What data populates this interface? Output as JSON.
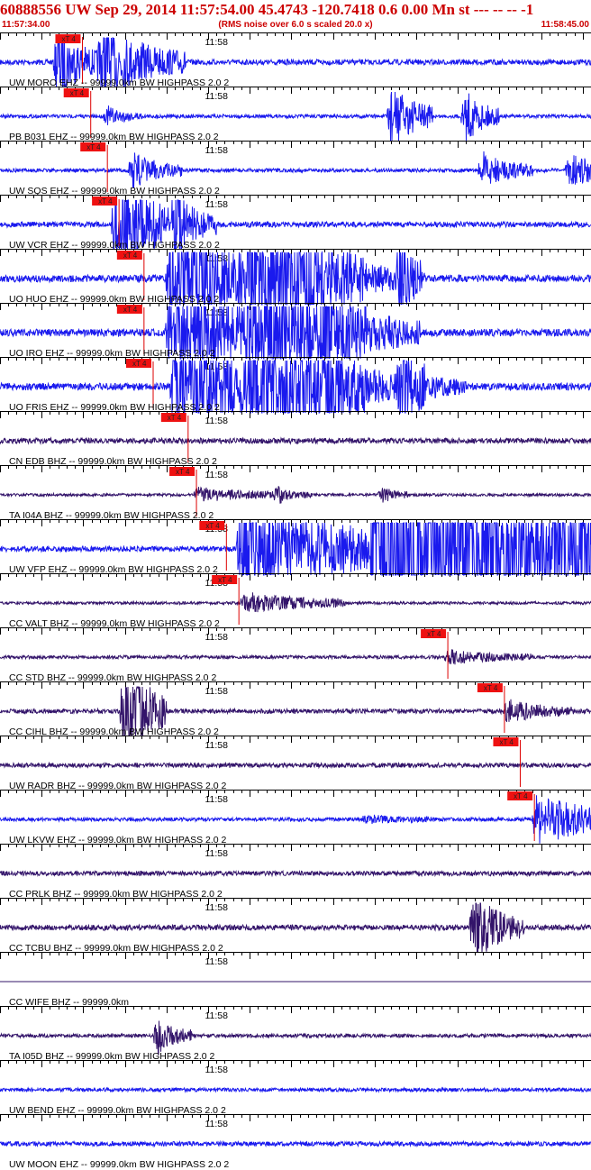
{
  "header": {
    "title": "60888556 UW Sep 29, 2014 11:57:54.00   45.4743 -120.7418  0.6 0.00 Mn st --- -- --  -1",
    "start_time": "11:57:34.00",
    "noise_note": "(RMS noise over 6.0 s scaled 20.0 x)",
    "end_time": "11:58:45.00"
  },
  "chart_data": {
    "type": "line",
    "x_unit": "seconds after 11:57:34.00",
    "xlim": [
      0,
      71
    ],
    "minute_mark": {
      "label": "11:58",
      "t": 26
    },
    "pick_label": "xT 4",
    "colors": {
      "ehz": "#1a1aee",
      "bhz": "#33146a",
      "pick_box": "#ee1111",
      "pick_line": "#dd0000",
      "axis": "#000000"
    },
    "traces": [
      {
        "label": "UW MORO EHZ -- 99999.0km BW  HIGHPASS  2.0  2",
        "kind": "ehz",
        "pick": 9.9,
        "amp": 3,
        "bursts": [
          [
            12.3,
            10,
            3.5
          ],
          [
            7,
            6,
            3
          ]
        ],
        "clip": false,
        "flat": false
      },
      {
        "label": "PB B031 EHZ -- 99999.0km BW  HIGHPASS  2.0  2",
        "kind": "ehz",
        "pick": 10.9,
        "amp": 2,
        "bursts": [
          [
            13,
            4,
            1
          ],
          [
            47,
            5,
            4
          ],
          [
            56,
            4,
            3
          ]
        ],
        "clip": false,
        "flat": false
      },
      {
        "label": "UW SQS EHZ -- 99999.0km BW  HIGHPASS  2.0  2",
        "kind": "ehz",
        "pick": 12.9,
        "amp": 2,
        "bursts": [
          [
            16,
            6,
            2
          ],
          [
            58,
            6,
            2
          ],
          [
            68.5,
            12,
            1.6
          ]
        ],
        "clip": false,
        "flat": false
      },
      {
        "label": "UW VCR EHZ -- 99999.0km BW  HIGHPASS  2.0  2",
        "kind": "ehz",
        "pick": 14.3,
        "amp": 3,
        "bursts": [
          [
            14,
            8,
            5
          ],
          [
            21,
            5,
            3
          ]
        ],
        "clip": false,
        "flat": false
      },
      {
        "label": "UO HUO EHZ -- 99999.0km BW  HIGHPASS  2.0  2",
        "kind": "ehz",
        "pick": 17.3,
        "amp": 4,
        "bursts": [
          [
            20.5,
            30,
            3
          ],
          [
            30,
            14,
            3
          ],
          [
            36,
            6,
            1.5
          ],
          [
            48,
            3,
            2
          ]
        ],
        "clip": true,
        "flat": false
      },
      {
        "label": "UO IRO EHZ -- 99999.0km BW  HIGHPASS  2.0  2",
        "kind": "ehz",
        "pick": 17.3,
        "amp": 4,
        "bursts": [
          [
            20.5,
            30,
            3
          ],
          [
            30,
            14,
            3
          ],
          [
            38,
            10,
            1
          ],
          [
            35.5,
            6,
            0.8
          ]
        ],
        "clip": true,
        "flat": false
      },
      {
        "label": "UO FRIS EHZ -- 99999.0km BW  HIGHPASS  2.0  2",
        "kind": "ehz",
        "pick": 18.4,
        "amp": 4,
        "bursts": [
          [
            21,
            30,
            3
          ],
          [
            30,
            14,
            3
          ],
          [
            38,
            8,
            1
          ],
          [
            48,
            8,
            1.5
          ]
        ],
        "clip": true,
        "flat": false
      },
      {
        "label": "CN EDB BHZ -- 99999.0km BW  HIGHPASS  2.0  2",
        "kind": "bhz",
        "pick": 22.6,
        "amp": 3,
        "bursts": [],
        "clip": false,
        "flat": false
      },
      {
        "label": "TA I04A BHZ -- 99999.0km BW  HIGHPASS  2.0  2",
        "kind": "bhz",
        "pick": 23.6,
        "amp": 1.5,
        "bursts": [
          [
            23.8,
            10,
            1
          ],
          [
            33.5,
            4,
            0.8
          ],
          [
            46,
            3,
            1
          ]
        ],
        "clip": false,
        "flat": false
      },
      {
        "label": "UW VFP EHZ -- 99999.0km BW  HIGHPASS  2.0  2",
        "kind": "ehz",
        "pick": 27.2,
        "amp": 3,
        "bursts": [
          [
            29,
            30,
            4
          ],
          [
            45,
            30,
            12
          ],
          [
            67,
            30,
            4
          ]
        ],
        "clip": true,
        "flat": false
      },
      {
        "label": "CC VALT BHZ -- 99999.0km BW  HIGHPASS  2.0  2",
        "kind": "bhz",
        "pick": 28.7,
        "amp": 1.5,
        "bursts": [
          [
            29.5,
            12,
            1.5
          ]
        ],
        "clip": false,
        "flat": false
      },
      {
        "label": "CC STD BHZ -- 99999.0km BW  HIGHPASS  2.0  2",
        "kind": "bhz",
        "pick": 53.8,
        "amp": 1.8,
        "bursts": [
          [
            54,
            10,
            0.8
          ]
        ],
        "clip": false,
        "flat": false
      },
      {
        "label": "CC CIHL BHZ -- 99999.0km BW  HIGHPASS  2.0  2",
        "kind": "bhz",
        "pick": 60.6,
        "amp": 2.5,
        "bursts": [
          [
            61,
            8,
            1
          ],
          [
            15,
            5,
            6
          ]
        ],
        "clip": false,
        "flat": false
      },
      {
        "label": "UW RADR BHZ -- 99999.0km BW  HIGHPASS  2.0  2",
        "kind": "bhz",
        "pick": 62.5,
        "amp": 2.5,
        "bursts": [],
        "clip": false,
        "flat": false
      },
      {
        "label": "UW LKVW EHZ -- 99999.0km BW  HIGHPASS  2.0  2",
        "kind": "ehz",
        "pick": 64.2,
        "amp": 2,
        "bursts": [
          [
            64.5,
            13,
            3
          ],
          [
            44,
            8,
            0.4
          ]
        ],
        "clip": false,
        "flat": false
      },
      {
        "label": "CC PRLK BHZ -- 99999.0km BW  HIGHPASS  2.0  2",
        "kind": "bhz",
        "pick": null,
        "amp": 2.5,
        "bursts": [],
        "clip": false,
        "flat": false
      },
      {
        "label": "CC TCBU BHZ -- 99999.0km BW  HIGHPASS  2.0  2",
        "kind": "bhz",
        "pick": null,
        "amp": 3,
        "bursts": [
          [
            57,
            6,
            3
          ]
        ],
        "clip": false,
        "flat": false
      },
      {
        "label": "CC WIFE BHZ -- 99999.0km",
        "kind": "bhz",
        "pick": null,
        "amp": 0,
        "bursts": [],
        "clip": false,
        "flat": true
      },
      {
        "label": "TA I05D BHZ -- 99999.0km BW  HIGHPASS  2.0  2",
        "kind": "bhz",
        "pick": null,
        "amp": 2,
        "bursts": [
          [
            19,
            4,
            2
          ]
        ],
        "clip": false,
        "flat": false
      },
      {
        "label": "UW BEND EHZ -- 99999.0km BW  HIGHPASS  2.0  2",
        "kind": "ehz",
        "pick": null,
        "amp": 2,
        "bursts": [],
        "clip": false,
        "flat": false
      },
      {
        "label": "UW MOON EHZ -- 99999.0km BW  HIGHPASS  2.0  2",
        "kind": "ehz",
        "pick": null,
        "amp": 2.5,
        "bursts": [],
        "clip": false,
        "flat": false
      }
    ]
  }
}
